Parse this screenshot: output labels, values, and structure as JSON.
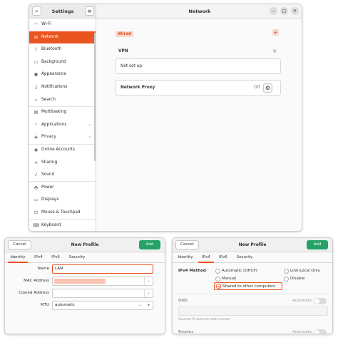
{
  "settings": {
    "sidebar_title": "Settings",
    "search_icon": "search-icon",
    "menu_icon": "hamburger-menu-icon",
    "window_title": "Network",
    "window_controls": {
      "minimize": "–",
      "maximize": "□",
      "close": "✕"
    },
    "items": [
      {
        "label": "Wi-Fi",
        "icon": "wifi-icon",
        "glyph": "◠"
      },
      {
        "label": "Network",
        "icon": "network-icon",
        "glyph": "⊞"
      },
      {
        "label": "Bluetooth",
        "icon": "bluetooth-icon",
        "glyph": "ᛒ"
      },
      {
        "label": "Background",
        "icon": "background-icon",
        "glyph": "▭"
      },
      {
        "label": "Appearance",
        "icon": "appearance-icon",
        "glyph": "▣"
      },
      {
        "label": "Notifications",
        "icon": "bell-icon",
        "glyph": "♫"
      },
      {
        "label": "Search",
        "icon": "search-icon",
        "glyph": "⌕"
      },
      {
        "label": "Multitasking",
        "icon": "multitasking-icon",
        "glyph": "▤"
      },
      {
        "label": "Applications",
        "icon": "applications-icon",
        "glyph": "⁙",
        "chevron": "›"
      },
      {
        "label": "Privacy",
        "icon": "privacy-icon",
        "glyph": "◈",
        "chevron": "›"
      },
      {
        "label": "Online Accounts",
        "icon": "online-accounts-icon",
        "glyph": "◉"
      },
      {
        "label": "Sharing",
        "icon": "sharing-icon",
        "glyph": "⋖"
      },
      {
        "label": "Sound",
        "icon": "music-note-icon",
        "glyph": "♪"
      },
      {
        "label": "Power",
        "icon": "power-icon",
        "glyph": "◓"
      },
      {
        "label": "Displays",
        "icon": "display-icon",
        "glyph": "▭"
      },
      {
        "label": "Mouse & Touchpad",
        "icon": "mouse-icon",
        "glyph": "⊡"
      },
      {
        "label": "Keyboard",
        "icon": "keyboard-icon",
        "glyph": "⌨"
      }
    ],
    "active_index": 1,
    "wired": {
      "label": "Wired",
      "add": "+"
    },
    "vpn": {
      "label": "VPN",
      "add": "+",
      "status": "Not set up"
    },
    "proxy": {
      "label": "Network Proxy",
      "status": "Off",
      "gear": "⚙"
    }
  },
  "dialog1": {
    "cancel": "Cancel",
    "title": "New Profile",
    "add": "Add",
    "tabs": [
      "Identity",
      "IPv4",
      "IPv6",
      "Security"
    ],
    "selected_tab": 0,
    "fields": {
      "name_label": "Name",
      "name_value": "LAN",
      "mac_label": "MAC Address",
      "cloned_label": "Cloned Address",
      "mtu_label": "MTU",
      "mtu_value": "automatic",
      "mtu_minus": "−",
      "mtu_plus": "+"
    }
  },
  "dialog2": {
    "cancel": "Cancel",
    "title": "New Profile",
    "add": "Add",
    "tabs": [
      "Identity",
      "IPv4",
      "IPv6",
      "Security"
    ],
    "selected_tab": 1,
    "ipv4_method_label": "IPv4 Method",
    "methods": {
      "auto": "Automatic (DHCP)",
      "link_local": "Link-Local Only",
      "manual": "Manual",
      "disable": "Disable",
      "shared": "Shared to other computers"
    },
    "dns_label": "DNS",
    "dns_auto": "Automatic",
    "dns_hint": "Separate IP addresses with commas",
    "routes_label": "Routes",
    "routes_auto": "Automatic"
  },
  "colors": {
    "accent": "#e95420",
    "add": "#26a269"
  }
}
